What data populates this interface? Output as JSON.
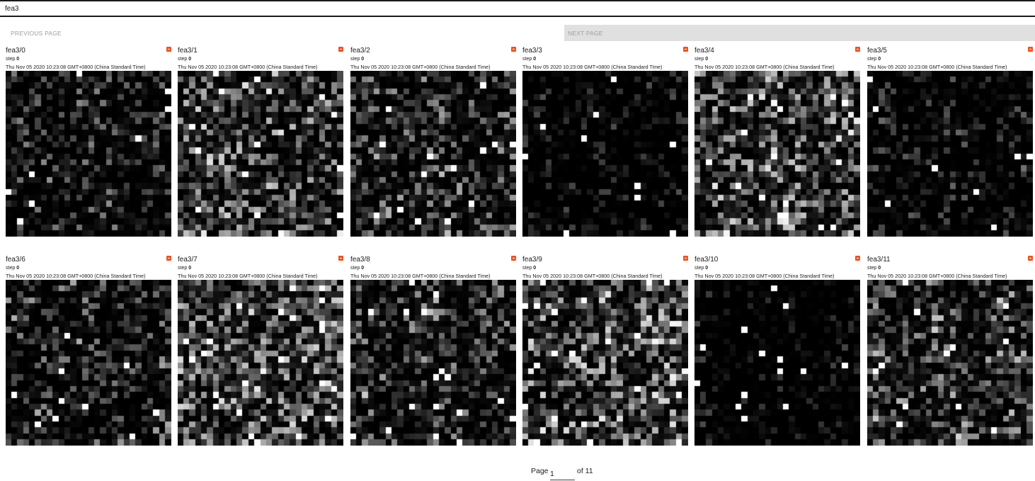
{
  "header": {
    "title": "fea3"
  },
  "pager": {
    "previous_label": "PREVIOUS PAGE",
    "next_label": "NEXT PAGE",
    "page_label": "Page",
    "current_page": "1",
    "of_label": "of 11"
  },
  "cards": [
    {
      "title": "fea3/0",
      "step_label": "step",
      "step": "0",
      "time": "Thu Nov 05 2020 10:23:08 GMT+0800 (China Standard Time)"
    },
    {
      "title": "fea3/1",
      "step_label": "step",
      "step": "0",
      "time": "Thu Nov 05 2020 10:23:08 GMT+0800 (China Standard Time)"
    },
    {
      "title": "fea3/2",
      "step_label": "step",
      "step": "0",
      "time": "Thu Nov 05 2020 10:23:08 GMT+0800 (China Standard Time)"
    },
    {
      "title": "fea3/3",
      "step_label": "step",
      "step": "0",
      "time": "Thu Nov 05 2020 10:23:08 GMT+0800 (China Standard Time)"
    },
    {
      "title": "fea3/4",
      "step_label": "step",
      "step": "0",
      "time": "Thu Nov 05 2020 10:23:08 GMT+0800 (China Standard Time)"
    },
    {
      "title": "fea3/5",
      "step_label": "step",
      "step": "0",
      "time": "Thu Nov 05 2020 10:23:08 GMT+0800 (China Standard Time)"
    },
    {
      "title": "fea3/6",
      "step_label": "step",
      "step": "0",
      "time": "Thu Nov 05 2020 10:23:08 GMT+0800 (China Standard Time)"
    },
    {
      "title": "fea3/7",
      "step_label": "step",
      "step": "0",
      "time": "Thu Nov 05 2020 10:23:08 GMT+0800 (China Standard Time)"
    },
    {
      "title": "fea3/8",
      "step_label": "step",
      "step": "0",
      "time": "Thu Nov 05 2020 10:23:08 GMT+0800 (China Standard Time)"
    },
    {
      "title": "fea3/9",
      "step_label": "step",
      "step": "0",
      "time": "Thu Nov 05 2020 10:23:08 GMT+0800 (China Standard Time)"
    },
    {
      "title": "fea3/10",
      "step_label": "step",
      "step": "0",
      "time": "Thu Nov 05 2020 10:23:08 GMT+0800 (China Standard Time)"
    },
    {
      "title": "fea3/11",
      "step_label": "step",
      "step": "0",
      "time": "Thu Nov 05 2020 10:23:08 GMT+0800 (China Standard Time)"
    }
  ],
  "colors": {
    "flag": "#f4511e",
    "next_button_bg": "#e0e0e0",
    "button_text": "#9e9e9e",
    "rule": "#1a1a1a"
  },
  "icons": {
    "card_flag": "pin-icon"
  }
}
